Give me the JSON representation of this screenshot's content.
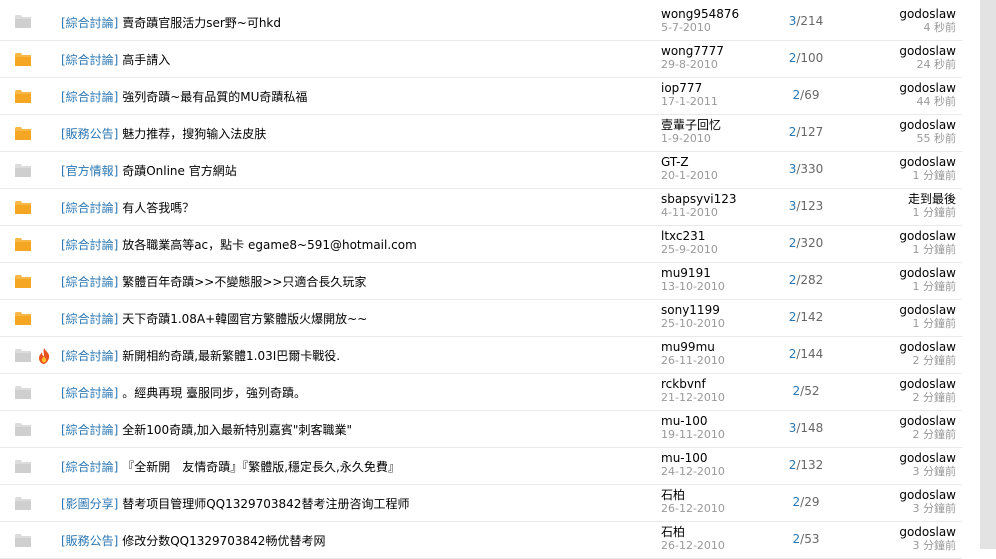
{
  "rows": [
    {
      "status": "read",
      "fire": false,
      "category": "[綜合討論]",
      "title": "賣奇蹟官服活力ser野~可hkd",
      "author": "wong954876",
      "date": "5-7-2010",
      "replies": "3",
      "views": "214",
      "last_user": "godoslaw",
      "last_time": "4 秒前"
    },
    {
      "status": "new",
      "fire": false,
      "category": "[綜合討論]",
      "title": "高手請入",
      "author": "wong7777",
      "date": "29-8-2010",
      "replies": "2",
      "views": "100",
      "last_user": "godoslaw",
      "last_time": "24 秒前"
    },
    {
      "status": "new",
      "fire": false,
      "category": "[綜合討論]",
      "title": "強列奇蹟~最有品質的MU奇蹟私福",
      "author": "iop777",
      "date": "17-1-2011",
      "replies": "2",
      "views": "69",
      "last_user": "godoslaw",
      "last_time": "44 秒前"
    },
    {
      "status": "new",
      "fire": false,
      "category": "[販務公告]",
      "title": "魅力推荐，搜狗输入法皮肤",
      "author": "壹輩子回忆",
      "date": "1-9-2010",
      "replies": "2",
      "views": "127",
      "last_user": "godoslaw",
      "last_time": "55 秒前"
    },
    {
      "status": "read",
      "fire": false,
      "category": "[官方情報]",
      "title": "奇蹟Online 官方網站",
      "author": "GT-Z",
      "date": "20-1-2010",
      "replies": "3",
      "views": "330",
      "last_user": "godoslaw",
      "last_time": "1 分鐘前"
    },
    {
      "status": "new",
      "fire": false,
      "category": "[綜合討論]",
      "title": "有人答我嗎？",
      "author": "sbapsyvi123",
      "date": "4-11-2010",
      "replies": "3",
      "views": "123",
      "last_user": "走到最後",
      "last_time": "1 分鐘前"
    },
    {
      "status": "new",
      "fire": false,
      "category": "[綜合討論]",
      "title": "放各職業高等ac，點卡 egame8~591@hotmail.com",
      "author": "ltxc231",
      "date": "25-9-2010",
      "replies": "2",
      "views": "320",
      "last_user": "godoslaw",
      "last_time": "1 分鐘前"
    },
    {
      "status": "new",
      "fire": false,
      "category": "[綜合討論]",
      "title": "繁體百年奇蹟>>不變態服>>只適合長久玩家",
      "author": "mu9191",
      "date": "13-10-2010",
      "replies": "2",
      "views": "282",
      "last_user": "godoslaw",
      "last_time": "1 分鐘前"
    },
    {
      "status": "new",
      "fire": false,
      "category": "[綜合討論]",
      "title": "天下奇蹟1.08A+韓國官方繁體版火爆開放~~",
      "author": "sony1199",
      "date": "25-10-2010",
      "replies": "2",
      "views": "142",
      "last_user": "godoslaw",
      "last_time": "1 分鐘前"
    },
    {
      "status": "read",
      "fire": true,
      "category": "[綜合討論]",
      "title": "新開相約奇蹟,最新繁體1.03I巴爾卡戰役.",
      "author": "mu99mu",
      "date": "26-11-2010",
      "replies": "2",
      "views": "144",
      "last_user": "godoslaw",
      "last_time": "2 分鐘前"
    },
    {
      "status": "read",
      "fire": false,
      "category": "[綜合討論]",
      "title": "。經典再現 臺服同步，強列奇蹟。",
      "author": "rckbvnf",
      "date": "21-12-2010",
      "replies": "2",
      "views": "52",
      "last_user": "godoslaw",
      "last_time": "2 分鐘前"
    },
    {
      "status": "read",
      "fire": false,
      "category": "[綜合討論]",
      "title": "全新100奇蹟,加入最新特別嘉賓\"刺客職業\"",
      "author": "mu-100",
      "date": "19-11-2010",
      "replies": "3",
      "views": "148",
      "last_user": "godoslaw",
      "last_time": "2 分鐘前"
    },
    {
      "status": "read",
      "fire": false,
      "category": "[綜合討論]",
      "title": "『全新開　友情奇蹟』『繁體版,穩定長久,永久免費』",
      "author": "mu-100",
      "date": "24-12-2010",
      "replies": "2",
      "views": "132",
      "last_user": "godoslaw",
      "last_time": "3 分鐘前"
    },
    {
      "status": "read",
      "fire": false,
      "category": "[影圖分享]",
      "title": "替考项目管理师QQ1329703842替考注册咨询工程师",
      "author": "石柏",
      "date": "26-12-2010",
      "replies": "2",
      "views": "29",
      "last_user": "godoslaw",
      "last_time": "3 分鐘前"
    },
    {
      "status": "read",
      "fire": false,
      "category": "[販務公告]",
      "title": "修改分数QQ1329703842畅优替考网",
      "author": "石柏",
      "date": "26-12-2010",
      "replies": "2",
      "views": "53",
      "last_user": "godoslaw",
      "last_time": "3 分鐘前"
    }
  ],
  "colors": {
    "link": "#2b77b3",
    "new_folder": "#f5a623",
    "read_folder": "#cfcfcf",
    "muted": "#999999"
  },
  "icons": {
    "new": "folder-new-icon",
    "read": "folder-read-icon",
    "hot": "fire-icon"
  }
}
